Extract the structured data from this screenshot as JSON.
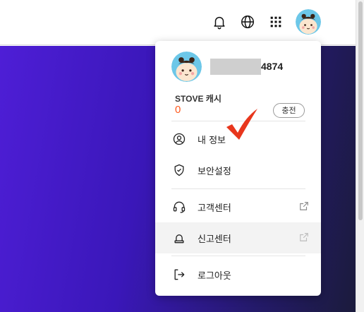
{
  "header": {
    "icons": [
      "bell-icon",
      "globe-icon",
      "apps-grid-icon"
    ],
    "avatar": "profile-avatar"
  },
  "menu": {
    "user_id_suffix": "4874",
    "cash_label": "STOVE 캐시",
    "cash_value": "0",
    "charge_label": "충전",
    "items": [
      {
        "label": "내 정보",
        "icon": "user-circle-icon"
      },
      {
        "label": "보안설정",
        "icon": "shield-check-icon"
      },
      {
        "label": "고객센터",
        "icon": "headset-icon",
        "external": true
      },
      {
        "label": "신고센터",
        "icon": "siren-icon",
        "external": true,
        "highlighted": true
      },
      {
        "label": "로그아웃",
        "icon": "logout-icon"
      }
    ]
  },
  "colors": {
    "cash_accent": "#ff5a1f",
    "checkmark": "#e8361c",
    "hero_gradient_start": "#4e1ed6",
    "hero_gradient_end": "#1b1b3c"
  }
}
